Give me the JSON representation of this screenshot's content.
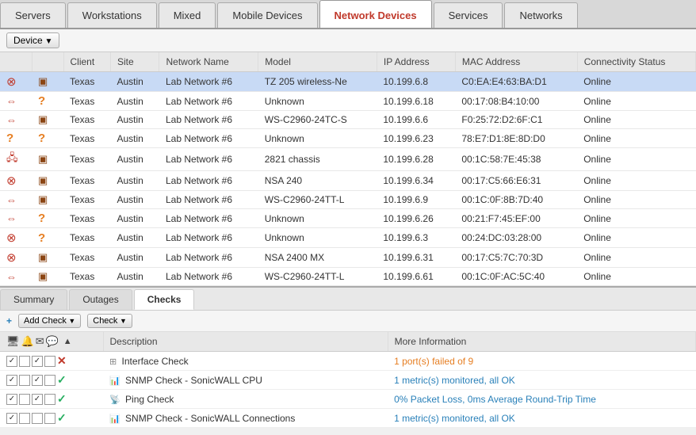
{
  "tabs": [
    {
      "id": "servers",
      "label": "Servers",
      "active": false
    },
    {
      "id": "workstations",
      "label": "Workstations",
      "active": false
    },
    {
      "id": "mixed",
      "label": "Mixed",
      "active": false
    },
    {
      "id": "mobile",
      "label": "Mobile Devices",
      "active": false
    },
    {
      "id": "network",
      "label": "Network Devices",
      "active": true
    },
    {
      "id": "services",
      "label": "Services",
      "active": false
    },
    {
      "id": "networks",
      "label": "Networks",
      "active": false
    }
  ],
  "toolbar": {
    "device_label": "Device"
  },
  "table": {
    "columns": [
      "",
      "",
      "Client",
      "Site",
      "Network Name",
      "Model",
      "IP Address",
      "MAC Address",
      "Connectivity Status"
    ],
    "rows": [
      {
        "icon1": "🔴",
        "icon2": "📦",
        "client": "Texas",
        "site": "Austin",
        "network": "Lab Network #6",
        "model": "TZ 205 wireless-Ne",
        "ip": "10.199.6.8",
        "mac": "C0:EA:E4:63:BA:D1",
        "status": "Online",
        "selected": true
      },
      {
        "icon1": "↔",
        "icon2": "?",
        "client": "Texas",
        "site": "Austin",
        "network": "Lab Network #6",
        "model": "Unknown",
        "ip": "10.199.6.18",
        "mac": "00:17:08:B4:10:00",
        "status": "Online",
        "selected": false
      },
      {
        "icon1": "↔",
        "icon2": "📦",
        "client": "Texas",
        "site": "Austin",
        "network": "Lab Network #6",
        "model": "WS-C2960-24TC-S",
        "ip": "10.199.6.6",
        "mac": "F0:25:72:D2:6F:C1",
        "status": "Online",
        "selected": false
      },
      {
        "icon1": "?",
        "icon2": "?",
        "client": "Texas",
        "site": "Austin",
        "network": "Lab Network #6",
        "model": "Unknown",
        "ip": "10.199.6.23",
        "mac": "78:E7:D1:8E:8D:D0",
        "status": "Online",
        "selected": false
      },
      {
        "icon1": "🖧",
        "icon2": "📦",
        "client": "Texas",
        "site": "Austin",
        "network": "Lab Network #6",
        "model": "2821 chassis",
        "ip": "10.199.6.28",
        "mac": "00:1C:58:7E:45:38",
        "status": "Online",
        "selected": false
      },
      {
        "icon1": "🔴",
        "icon2": "📦",
        "client": "Texas",
        "site": "Austin",
        "network": "Lab Network #6",
        "model": "NSA 240",
        "ip": "10.199.6.34",
        "mac": "00:17:C5:66:E6:31",
        "status": "Online",
        "selected": false
      },
      {
        "icon1": "↔",
        "icon2": "📦",
        "client": "Texas",
        "site": "Austin",
        "network": "Lab Network #6",
        "model": "WS-C2960-24TT-L",
        "ip": "10.199.6.9",
        "mac": "00:1C:0F:8B:7D:40",
        "status": "Online",
        "selected": false
      },
      {
        "icon1": "↔",
        "icon2": "?",
        "client": "Texas",
        "site": "Austin",
        "network": "Lab Network #6",
        "model": "Unknown",
        "ip": "10.199.6.26",
        "mac": "00:21:F7:45:EF:00",
        "status": "Online",
        "selected": false
      },
      {
        "icon1": "🔴",
        "icon2": "?",
        "client": "Texas",
        "site": "Austin",
        "network": "Lab Network #6",
        "model": "Unknown",
        "ip": "10.199.6.3",
        "mac": "00:24:DC:03:28:00",
        "status": "Online",
        "selected": false
      },
      {
        "icon1": "🔴",
        "icon2": "📦",
        "client": "Texas",
        "site": "Austin",
        "network": "Lab Network #6",
        "model": "NSA 2400 MX",
        "ip": "10.199.6.31",
        "mac": "00:17:C5:7C:70:3D",
        "status": "Online",
        "selected": false
      },
      {
        "icon1": "↔",
        "icon2": "📦",
        "client": "Texas",
        "site": "Austin",
        "network": "Lab Network #6",
        "model": "WS-C2960-24TT-L",
        "ip": "10.199.6.61",
        "mac": "00:1C:0F:AC:5C:40",
        "status": "Online",
        "selected": false
      }
    ]
  },
  "bottom_tabs": [
    {
      "id": "summary",
      "label": "Summary",
      "active": false
    },
    {
      "id": "outages",
      "label": "Outages",
      "active": false
    },
    {
      "id": "checks",
      "label": "Checks",
      "active": true
    }
  ],
  "checks_toolbar": {
    "add_check_label": "Add Check",
    "check_label": "Check"
  },
  "checks_columns": [
    "",
    "Description",
    "More Information"
  ],
  "checks_rows": [
    {
      "cb1": true,
      "cb2": false,
      "cb3": true,
      "cb4": false,
      "enabled": true,
      "status": "x",
      "desc_icon": "⊞",
      "description": "Interface Check",
      "info": "1 port(s) failed of 9",
      "info_class": "link-orange"
    },
    {
      "cb1": true,
      "cb2": false,
      "cb3": true,
      "cb4": false,
      "enabled": true,
      "status": "ok",
      "desc_icon": "📊",
      "description": "SNMP Check - SonicWALL CPU",
      "info": "1 metric(s) monitored, all OK",
      "info_class": "link-blue"
    },
    {
      "cb1": true,
      "cb2": false,
      "cb3": true,
      "cb4": false,
      "enabled": true,
      "status": "ok",
      "desc_icon": "📡",
      "description": "Ping Check",
      "info": "0% Packet Loss, 0ms Average Round-Trip Time",
      "info_class": "link-blue"
    },
    {
      "cb1": true,
      "cb2": false,
      "cb3": false,
      "cb4": false,
      "enabled": true,
      "status": "ok",
      "desc_icon": "📊",
      "description": "SNMP Check - SonicWALL Connections",
      "info": "1 metric(s) monitored, all OK",
      "info_class": "link-blue"
    }
  ]
}
